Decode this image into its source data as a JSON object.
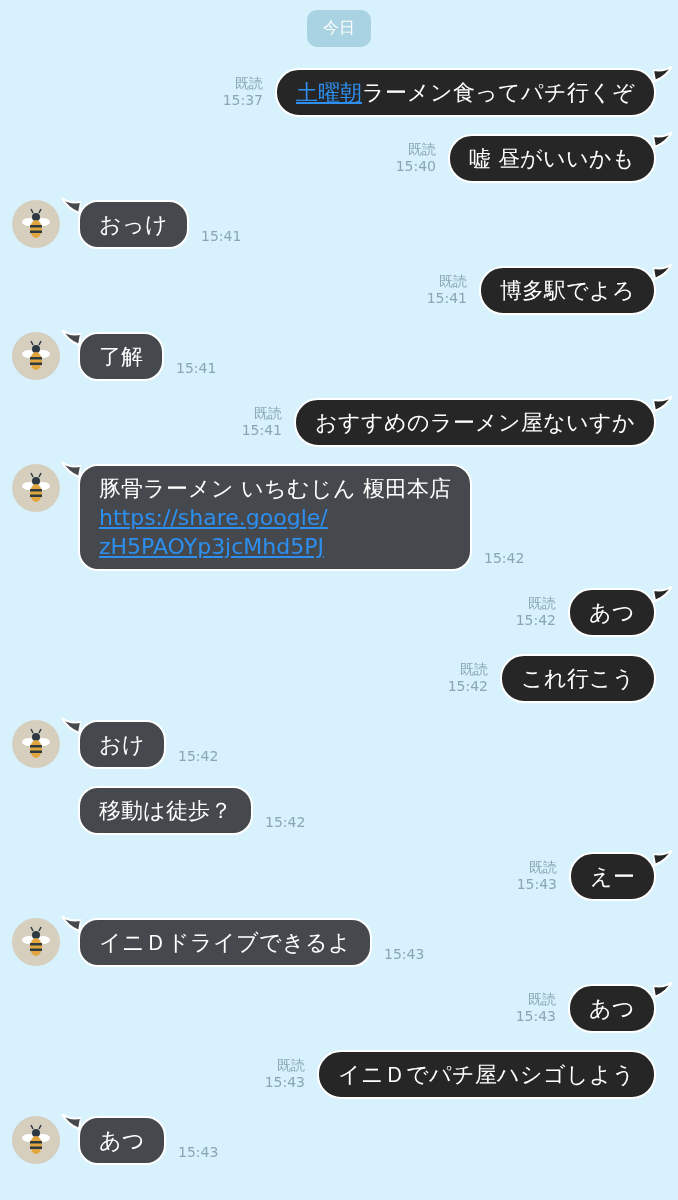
{
  "date_label": "今日",
  "messages": [
    {
      "kind": "out",
      "read": "既読",
      "time": "15:37",
      "tail": true,
      "lines": [
        [
          {
            "text": "土曜朝",
            "link": true
          },
          {
            "text": "ラーメン食ってパチ行くぞ"
          }
        ]
      ]
    },
    {
      "kind": "out",
      "read": "既読",
      "time": "15:40",
      "tail": true,
      "lines": [
        [
          {
            "text": "嘘  昼がいいかも"
          }
        ]
      ]
    },
    {
      "kind": "in",
      "avatar": true,
      "time": "15:41",
      "tail": true,
      "lines": [
        [
          {
            "text": "おっけ"
          }
        ]
      ]
    },
    {
      "kind": "out",
      "read": "既読",
      "time": "15:41",
      "tail": true,
      "lines": [
        [
          {
            "text": "博多駅でよろ"
          }
        ]
      ]
    },
    {
      "kind": "in",
      "avatar": true,
      "time": "15:41",
      "tail": true,
      "lines": [
        [
          {
            "text": "了解"
          }
        ]
      ]
    },
    {
      "kind": "out",
      "read": "既読",
      "time": "15:41",
      "tail": true,
      "lines": [
        [
          {
            "text": "おすすめのラーメン屋ないすか"
          }
        ]
      ]
    },
    {
      "kind": "in",
      "avatar": true,
      "time": "15:42",
      "tail": true,
      "lines": [
        [
          {
            "text": "豚骨ラーメン いちむじん 榎田本店"
          }
        ],
        [
          {
            "text": "https://share.google/",
            "link": true
          }
        ],
        [
          {
            "text": "zH5PAOYp3jcMhd5PJ",
            "link": true
          }
        ]
      ]
    },
    {
      "kind": "out",
      "read": "既読",
      "time": "15:42",
      "tail": true,
      "lines": [
        [
          {
            "text": "あつ"
          }
        ]
      ]
    },
    {
      "kind": "out",
      "read": "既読",
      "time": "15:42",
      "tail": false,
      "lines": [
        [
          {
            "text": "これ行こう"
          }
        ]
      ]
    },
    {
      "kind": "in",
      "avatar": true,
      "time": "15:42",
      "tail": true,
      "lines": [
        [
          {
            "text": "おけ"
          }
        ]
      ]
    },
    {
      "kind": "in",
      "avatar": false,
      "time": "15:42",
      "tail": false,
      "lines": [
        [
          {
            "text": "移動は徒歩？"
          }
        ]
      ]
    },
    {
      "kind": "out",
      "read": "既読",
      "time": "15:43",
      "tail": true,
      "lines": [
        [
          {
            "text": "えー"
          }
        ]
      ]
    },
    {
      "kind": "in",
      "avatar": true,
      "time": "15:43",
      "tail": true,
      "lines": [
        [
          {
            "text": "イニＤドライブできるよ"
          }
        ]
      ]
    },
    {
      "kind": "out",
      "read": "既読",
      "time": "15:43",
      "tail": true,
      "lines": [
        [
          {
            "text": "あつ"
          }
        ]
      ]
    },
    {
      "kind": "out",
      "read": "既読",
      "time": "15:43",
      "tail": false,
      "lines": [
        [
          {
            "text": "イニＤでパチ屋ハシゴしよう"
          }
        ]
      ]
    },
    {
      "kind": "in",
      "avatar": true,
      "time": "15:43",
      "tail": true,
      "lines": [
        [
          {
            "text": "あつ"
          }
        ]
      ]
    }
  ]
}
